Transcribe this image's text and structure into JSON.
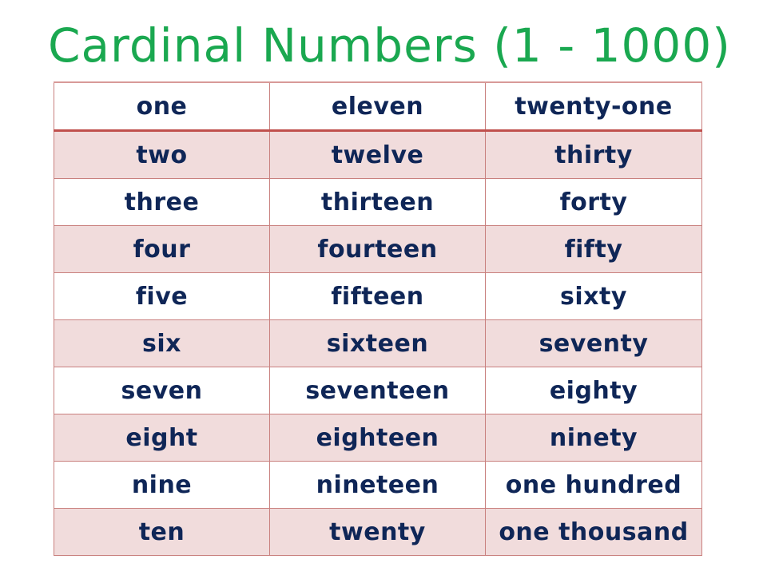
{
  "title": "Cardinal Numbers (1 - 1000)",
  "colors": {
    "title": "#1aa850",
    "text": "#0f2657",
    "row_shade": "#f1dcdc",
    "border": "#c0504d"
  },
  "rows": [
    [
      "one",
      "eleven",
      "twenty-one"
    ],
    [
      "two",
      "twelve",
      "thirty"
    ],
    [
      "three",
      "thirteen",
      "forty"
    ],
    [
      "four",
      "fourteen",
      "fifty"
    ],
    [
      "five",
      "fifteen",
      "sixty"
    ],
    [
      "six",
      "sixteen",
      "seventy"
    ],
    [
      "seven",
      "seventeen",
      "eighty"
    ],
    [
      "eight",
      "eighteen",
      "ninety"
    ],
    [
      "nine",
      "nineteen",
      "one hundred"
    ],
    [
      "ten",
      "twenty",
      "one thousand"
    ]
  ]
}
